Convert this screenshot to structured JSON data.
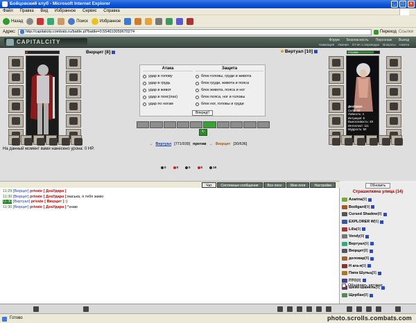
{
  "window": {
    "title": "Бойцовский клуб - Microsoft Internet Explorer"
  },
  "menu": {
    "items": [
      "Файл",
      "Правка",
      "Вид",
      "Избранное",
      "Сервис",
      "Справка"
    ]
  },
  "toolbar": {
    "back": "Назад",
    "search": "Поиск",
    "favorites": "Избранное"
  },
  "address": {
    "label": "Адрес:",
    "url": "http://capitalcity.combats.ru/battle.pl?battle=0.554610059670274",
    "go": "Переход",
    "links": "Ссылки"
  },
  "game": {
    "logo": "CAPITALCITY",
    "nav": [
      "Форум",
      "Безопасность",
      "Персонаж",
      "Выход"
    ],
    "subnav": [
      "Навигация",
      "Умения",
      "Отчет о переводах",
      "Вопросы",
      "Анкета"
    ]
  },
  "player_left": {
    "name": "Вюрцит [8]",
    "hp": "?? ???"
  },
  "player_right": {
    "name": "Вертуал [10]",
    "hp": "771/939",
    "stats": [
      "ДеаУдара",
      "Сила: 16",
      "Ловкость: 4",
      "Интуиция: 5",
      "Выносливость: 48",
      "Интеллект: 111",
      "Мудрость: 50"
    ]
  },
  "attack": {
    "title": "Атака",
    "options": [
      "удар в голову",
      "удар в грудь",
      "удар в живот",
      "удар в пояс(пах)",
      "удар по ногам"
    ]
  },
  "defense": {
    "title": "Защита",
    "options": [
      "блок головы, груди и живота",
      "блок груди, живота и пояса",
      "блок живота, пояса и ног",
      "блок пояса, ног и головы",
      "блок ног, головы и груди"
    ]
  },
  "fight": {
    "confirm": "Вперед!!",
    "counters": [
      "0",
      "0",
      "0",
      "0",
      "15"
    ]
  },
  "versus": {
    "left_name": "Вертуал",
    "left_hp": "[771/939]",
    "middle": "против",
    "right_name": "Вюрцит",
    "right_hp": "[30/636]"
  },
  "damage_msg": "На данный момент вами нанесено урона: 0 HP.",
  "tabs": [
    "Чат",
    "Системные сообщения",
    "Все логи",
    "Мои логи",
    "Настройки"
  ],
  "chat": [
    {
      "time": "11:29",
      "nick": "[Вюрцит]",
      "tag": "private [ ДеаУдара ]",
      "text": ""
    },
    {
      "time": "11:30",
      "nick": "[Вюрцит]",
      "tag": "private [ ДеаУдара ]",
      "text": "маська, я тебя замю"
    },
    {
      "time": "11:30",
      "nick": "[Вертуал]",
      "tag": "private [ Вюрцит ]",
      "text": ":)"
    },
    {
      "time": "11:30",
      "nick": "[Вюрцит]",
      "tag": "private [ ДеаУдара ]",
      "text": "*знаю"
    }
  ],
  "sidebar": {
    "refresh": "Обновить",
    "location": "Страшилкина улица (14)",
    "users": [
      {
        "name": "Azarina",
        "lv": "[9]"
      },
      {
        "name": "Bodigard",
        "lv": "[9]"
      },
      {
        "name": "Cursed Shadow",
        "lv": "[8]"
      },
      {
        "name": "EXPLORER W",
        "lv": "[6]"
      },
      {
        "name": "Lilia",
        "lv": "[9]"
      },
      {
        "name": "Vendy",
        "lv": "[8]"
      },
      {
        "name": "Вертуал",
        "lv": "[9]"
      },
      {
        "name": "Вюрцит",
        "lv": "[8]"
      },
      {
        "name": "деловар",
        "lv": "[8]"
      },
      {
        "name": "Н ага-я",
        "lv": "[9]"
      },
      {
        "name": "Папа Шульц",
        "lv": "[9]"
      },
      {
        "name": "ПТО",
        "lv": "[8]"
      },
      {
        "name": "Шейх-Шанель",
        "lv": "[9]"
      },
      {
        "name": "Щербан",
        "lv": "[8]"
      }
    ],
    "auto": "Обновлять автомат."
  },
  "statusbar": {
    "text": "Готово"
  },
  "watermark": "photo.scrolls.combats.com",
  "colors": {
    "title_blue": "#0b52d6",
    "hp_green": "#2c8c2c",
    "private_red": "#c00000",
    "nick_blue": "#1a3bb5",
    "location_red": "#8b0000"
  }
}
